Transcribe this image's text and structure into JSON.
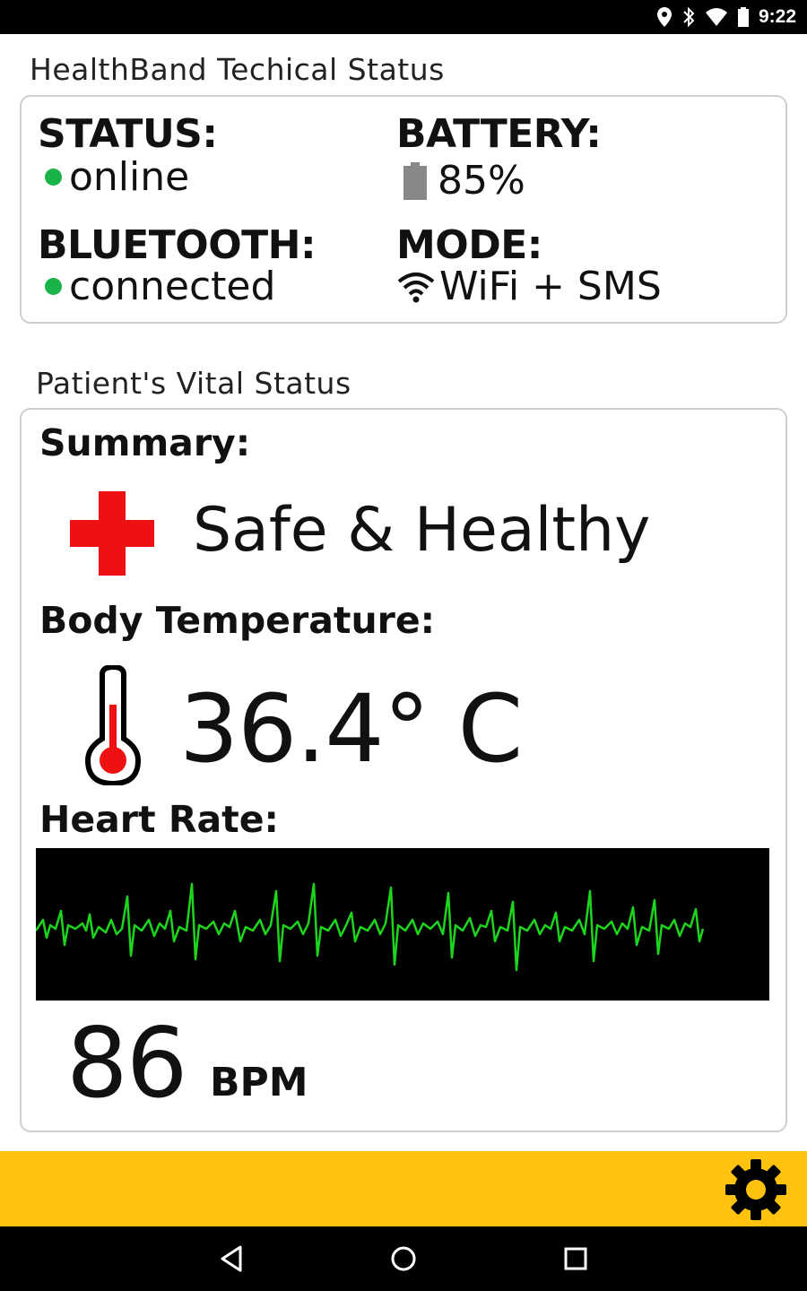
{
  "statusbar": {
    "time": "9:22",
    "icons": [
      "location-icon",
      "bluetooth-icon",
      "wifi-icon",
      "battery-icon"
    ]
  },
  "tech": {
    "title": "HealthBand Techical Status",
    "status_label": "STATUS:",
    "status_value": "online",
    "battery_label": "BATTERY:",
    "battery_value": "85%",
    "bluetooth_label": "BLUETOOTH:",
    "bluetooth_value": "connected",
    "mode_label": "MODE:",
    "mode_value": "WiFi + SMS"
  },
  "vital": {
    "title": "Patient's Vital Status",
    "summary_label": "Summary:",
    "summary_value": "Safe & Healthy",
    "temp_label": "Body Temperature:",
    "temp_value": "36.4° C",
    "hr_label": "Heart Rate:",
    "hr_value": "86",
    "hr_unit": "BPM"
  },
  "colors": {
    "online": "#1ab34a",
    "accent_bar": "#ffc30f",
    "cross": "#ee1111",
    "ecg_line": "#1ed51e"
  },
  "navbar": {
    "buttons": [
      "back-icon",
      "home-icon",
      "recents-icon"
    ]
  }
}
